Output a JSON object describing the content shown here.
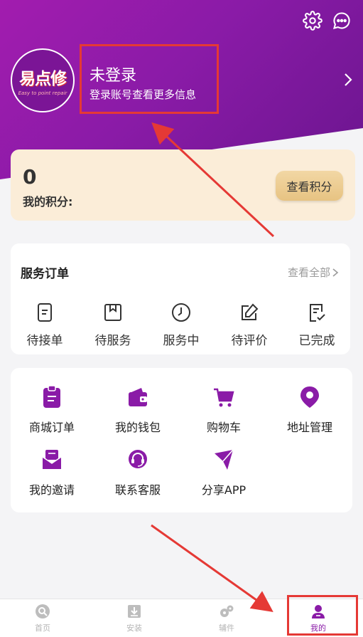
{
  "header": {
    "logo_main": "易点修",
    "logo_sub": "Easy to point repair",
    "login_title": "未登录",
    "login_subtitle": "登录账号查看更多信息"
  },
  "points": {
    "value": "0",
    "label": "我的积分:",
    "button": "查看积分"
  },
  "orders": {
    "title": "服务订单",
    "view_all": "查看全部",
    "items": [
      {
        "label": "待接单",
        "icon": "clipboard-list-icon"
      },
      {
        "label": "待服务",
        "icon": "box-icon"
      },
      {
        "label": "服务中",
        "icon": "clock-icon"
      },
      {
        "label": "待评价",
        "icon": "edit-icon"
      },
      {
        "label": "已完成",
        "icon": "check-list-icon"
      }
    ]
  },
  "tools": {
    "items": [
      {
        "label": "商城订单",
        "icon": "order-clipboard-icon"
      },
      {
        "label": "我的钱包",
        "icon": "wallet-icon"
      },
      {
        "label": "购物车",
        "icon": "cart-icon"
      },
      {
        "label": "地址管理",
        "icon": "location-pin-icon"
      },
      {
        "label": "我的邀请",
        "icon": "mail-icon"
      },
      {
        "label": "联系客服",
        "icon": "headset-icon"
      },
      {
        "label": "分享APP",
        "icon": "send-icon"
      }
    ]
  },
  "tabbar": {
    "items": [
      {
        "label": "首页",
        "icon": "home-search-icon"
      },
      {
        "label": "安装",
        "icon": "install-icon"
      },
      {
        "label": "辅件",
        "icon": "gears-icon"
      },
      {
        "label": "我的",
        "icon": "user-icon"
      }
    ],
    "active_index": 3
  },
  "colors": {
    "brand": "#8a1ba7",
    "annotation": "#e53935",
    "points_bg": "#fbedd8"
  }
}
